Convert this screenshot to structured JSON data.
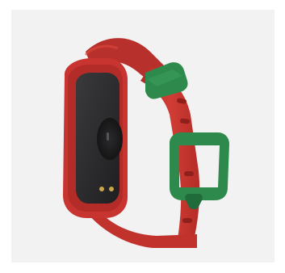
{
  "image": {
    "subject": "fitness-band-back-view",
    "colors": {
      "strap": "#c8342f",
      "strap_shadow": "#a62520",
      "strap_highlight": "#dc4a40",
      "keeper": "#2e8a4c",
      "keeper_shadow": "#206b3a",
      "body_back": "#2b2b2d",
      "background": "#f2f2f2"
    }
  }
}
